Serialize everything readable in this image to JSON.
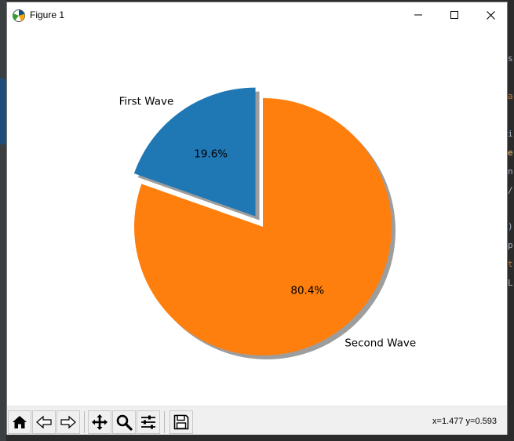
{
  "window": {
    "title": "Figure 1",
    "app_icon": "matplotlib-figure-icon",
    "controls": [
      "minimize-icon",
      "maximize-icon",
      "close-icon"
    ]
  },
  "chart_data": {
    "type": "pie",
    "title": "",
    "labels": [
      "First Wave",
      "Second Wave"
    ],
    "values": [
      19.6,
      80.4
    ],
    "autopct": [
      "19.6%",
      "80.4%"
    ],
    "explode": [
      0.1,
      0
    ],
    "shadow": true,
    "startangle": 90,
    "colors": [
      "#1f77b4",
      "#ff7f0e"
    ],
    "legend": false,
    "grid": false
  },
  "toolbar": {
    "buttons": [
      "home-icon",
      "back-icon",
      "forward-icon",
      "pan-icon",
      "zoom-icon",
      "subplots-icon",
      "save-icon"
    ],
    "status": "x=1.477 y=0.593"
  },
  "background": {
    "right_glyphs": [
      "s",
      "a",
      "i",
      "e",
      "n",
      "/",
      ")",
      "p",
      "t",
      "L"
    ],
    "right_glyph_colors": [
      "#a9b7c6",
      "#cc7832",
      "#a9b7c6",
      "#ffc66d",
      "#a9b7c6",
      "#a9b7c6",
      "#a9b7c6",
      "#a9b7c6",
      "#cc7832",
      "#a9b7c6"
    ]
  }
}
